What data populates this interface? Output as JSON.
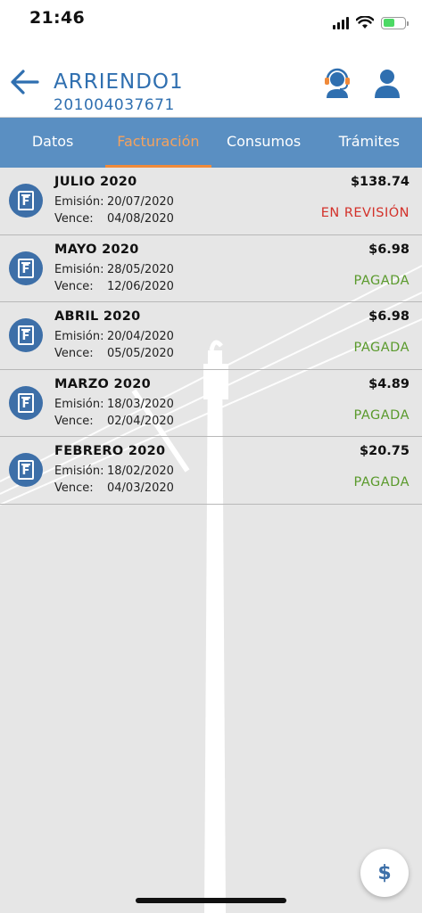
{
  "status_bar": {
    "time": "21:46",
    "battery_level": 0.55,
    "icons": [
      "signal-icon",
      "wifi-icon",
      "battery-charging-icon"
    ]
  },
  "header": {
    "account_name": "ARRIENDO1",
    "account_number": "201004037671",
    "back_icon": "back-arrow-icon",
    "support_icon": "support-agent-icon",
    "profile_icon": "user-icon"
  },
  "tabs": [
    {
      "label": "Datos",
      "active": false
    },
    {
      "label": "Facturación",
      "active": true
    },
    {
      "label": "Consumos",
      "active": false
    },
    {
      "label": "Trámites",
      "active": false
    }
  ],
  "invoices": [
    {
      "month": "JULIO 2020",
      "emision_label": "Emisión:",
      "emision": "20/07/2020",
      "vence_label": "Vence:",
      "vence": "04/08/2020",
      "amount": "$138.74",
      "status": "EN REVISIÓN",
      "status_type": "review"
    },
    {
      "month": "MAYO 2020",
      "emision_label": "Emisión:",
      "emision": "28/05/2020",
      "vence_label": "Vence:",
      "vence": "12/06/2020",
      "amount": "$6.98",
      "status": "PAGADA",
      "status_type": "paid"
    },
    {
      "month": "ABRIL 2020",
      "emision_label": "Emisión:",
      "emision": "20/04/2020",
      "vence_label": "Vence:",
      "vence": "05/05/2020",
      "amount": "$6.98",
      "status": "PAGADA",
      "status_type": "paid"
    },
    {
      "month": "MARZO 2020",
      "emision_label": "Emisión:",
      "emision": "18/03/2020",
      "vence_label": "Vence:",
      "vence": "02/04/2020",
      "amount": "$4.89",
      "status": "PAGADA",
      "status_type": "paid"
    },
    {
      "month": "FEBRERO 2020",
      "emision_label": "Emisión:",
      "emision": "18/02/2020",
      "vence_label": "Vence:",
      "vence": "04/03/2020",
      "amount": "$20.75",
      "status": "PAGADA",
      "status_type": "paid"
    }
  ],
  "invoice_icon": {
    "name": "invoice-document-icon",
    "letter": "F"
  },
  "fab": {
    "label": "$",
    "icon": "pay-dollar-icon"
  },
  "colors": {
    "brand_blue": "#2f6fb0",
    "tab_bar": "#5a8fc2",
    "tab_active": "#f08a3a",
    "paid": "#5a9a2c",
    "review": "#d3312a"
  }
}
